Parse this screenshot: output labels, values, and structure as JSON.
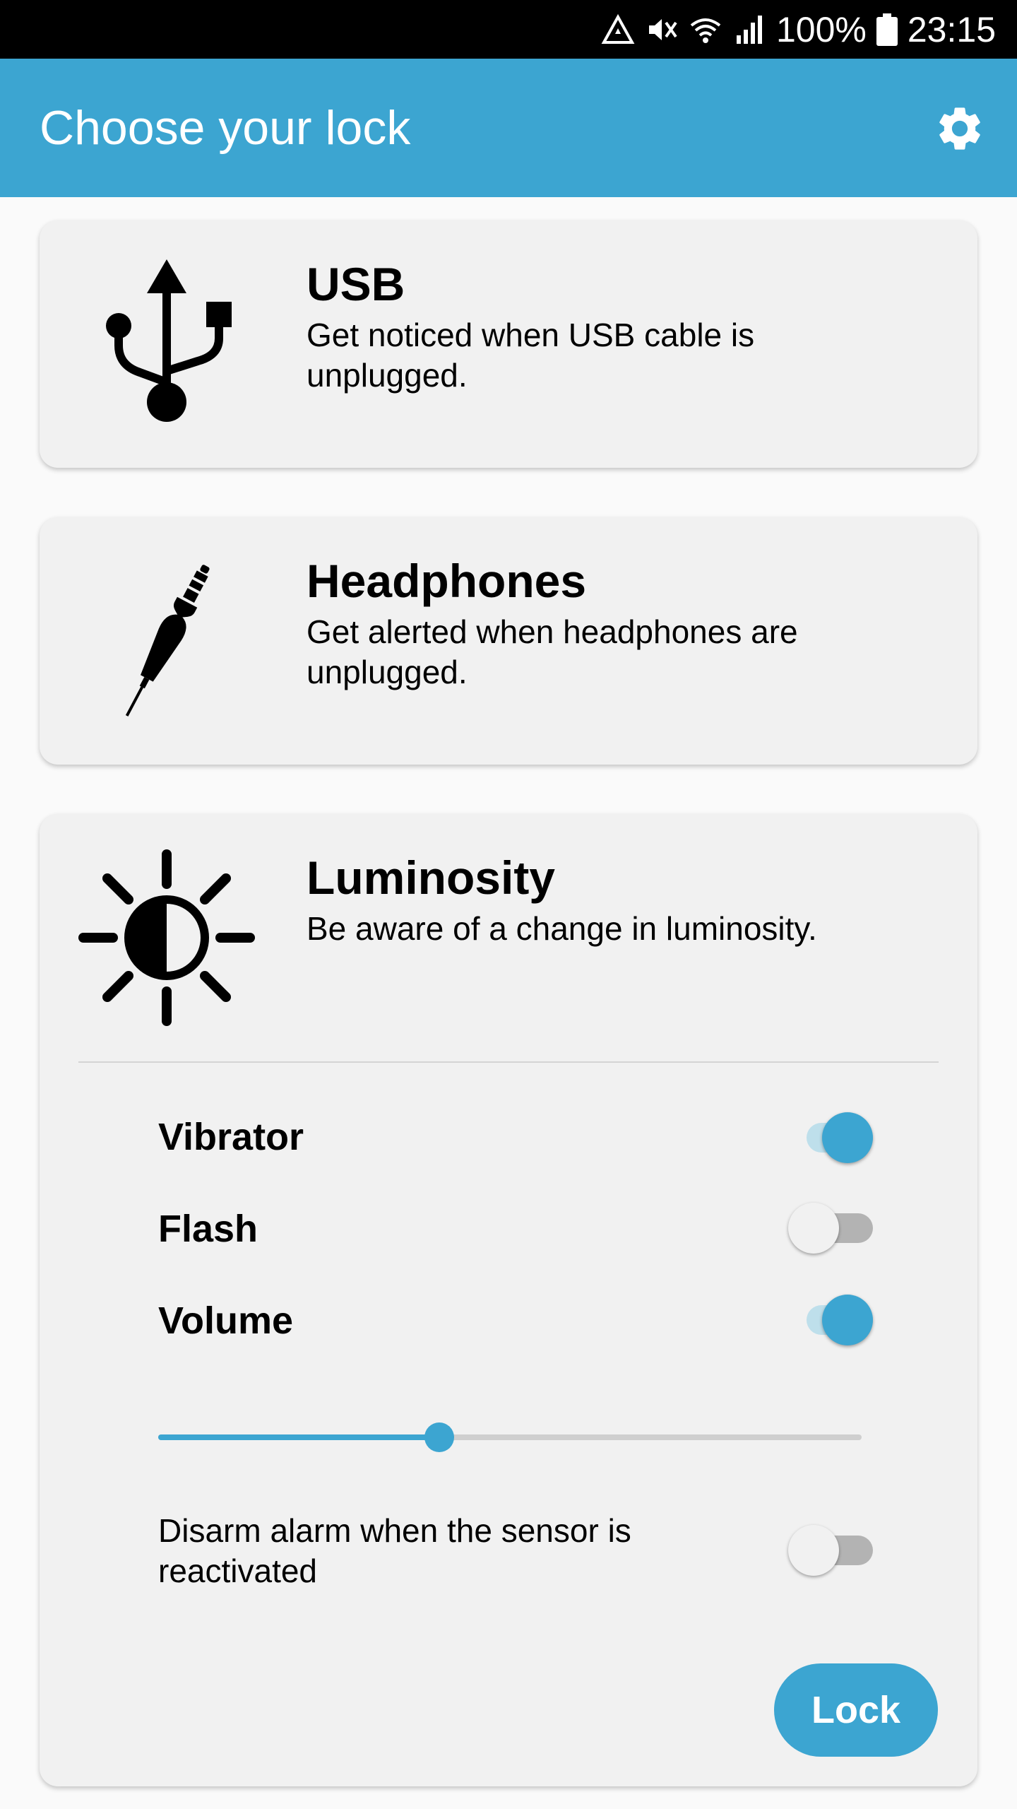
{
  "status_bar": {
    "battery": "100%",
    "time": "23:15",
    "icons": [
      "alert-triangle-icon",
      "mute-icon",
      "wifi-icon",
      "signal-icon",
      "battery-icon"
    ]
  },
  "app_bar": {
    "title": "Choose your lock",
    "settings_icon": "gear-icon",
    "color": "#3ca5d1"
  },
  "cards": {
    "usb": {
      "icon": "usb-icon",
      "title": "USB",
      "description": "Get noticed when USB cable is unplugged."
    },
    "headphones": {
      "icon": "headphone-jack-icon",
      "title": "Headphones",
      "description": "Get alerted when headphones are unplugged."
    },
    "luminosity": {
      "icon": "brightness-icon",
      "title": "Luminosity",
      "description": "Be aware of a change in luminosity.",
      "options": {
        "vibrator": {
          "label": "Vibrator",
          "enabled": true
        },
        "flash": {
          "label": "Flash",
          "enabled": false
        },
        "volume": {
          "label": "Volume",
          "enabled": true,
          "level": 0.4
        },
        "disarm": {
          "label": "Disarm alarm when the sensor is reactivated",
          "enabled": false
        }
      },
      "lock_button": "Lock"
    }
  }
}
